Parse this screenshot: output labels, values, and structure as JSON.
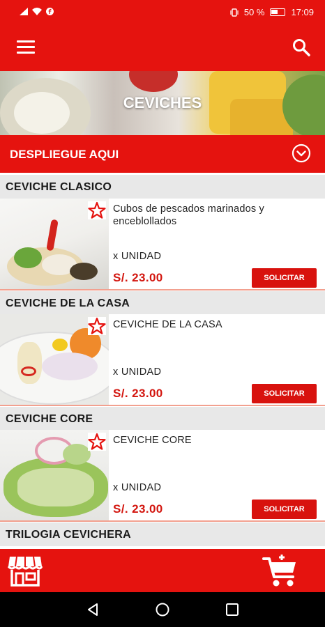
{
  "status_bar": {
    "battery_text": "50 %",
    "time": "17:09"
  },
  "app_bar": {
    "menu_icon": "hamburger-menu-icon",
    "search_icon": "search-icon"
  },
  "banner": {
    "title": "CEVICHES"
  },
  "dropdown": {
    "label": "DESPLIEGUE AQUI",
    "icon": "chevron-down-circle-icon"
  },
  "sections": [
    {
      "title": "CEVICHE CLASICO",
      "description": "Cubos de pescados marinados y enceblollados",
      "unit": "x UNIDAD",
      "price": "S/. 23.00",
      "button": "SOLICITAR"
    },
    {
      "title": "CEVICHE DE LA CASA",
      "description": "CEVICHE DE LA CASA",
      "unit": "x UNIDAD",
      "price": "S/. 23.00",
      "button": "SOLICITAR"
    },
    {
      "title": "CEVICHE CORE",
      "description": "CEVICHE CORE",
      "unit": "x UNIDAD",
      "price": "S/. 23.00",
      "button": "SOLICITAR"
    },
    {
      "title": "TRILOGIA CEVICHERA"
    }
  ],
  "bottom_bar": {
    "left_icon": "store-icon",
    "right_icon": "shopping-cart-icon"
  },
  "colors": {
    "brand_red": "#e5130f",
    "price_red": "#d3160f",
    "section_gray": "#e8e8e8"
  }
}
